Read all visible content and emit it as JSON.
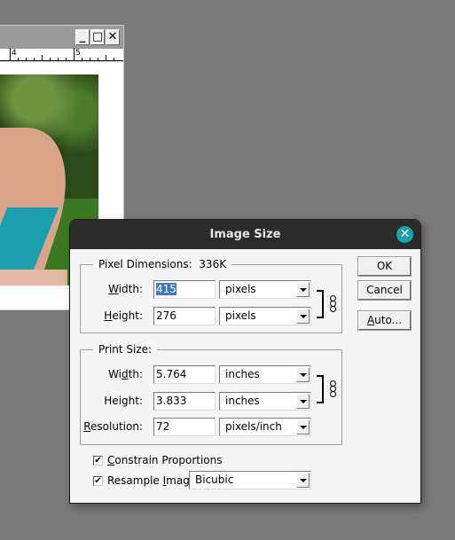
{
  "document_window": {
    "buttons": {
      "minimize": "_",
      "maximize": "□",
      "close": "✕"
    },
    "ruler": {
      "labels": [
        "4",
        "5"
      ]
    }
  },
  "dialog": {
    "title": "Image Size",
    "close_icon": "✕",
    "pixel_dimensions": {
      "title": "Pixel Dimensions:",
      "size": "336K",
      "width": {
        "label_prefix": "",
        "label_mnemonic": "W",
        "label_rest": "idth:",
        "value": "415",
        "unit": "pixels"
      },
      "height": {
        "label_mnemonic": "H",
        "label_rest": "eight:",
        "value": "276",
        "unit": "pixels"
      }
    },
    "print_size": {
      "title": "Print Size:",
      "width": {
        "label_prefix": "Wi",
        "label_mnemonic": "d",
        "label_rest": "th:",
        "value": "5.764",
        "unit": "inches"
      },
      "height": {
        "label": "Height:",
        "value": "3.833",
        "unit": "inches"
      },
      "resolution": {
        "label_mnemonic": "R",
        "label_rest": "esolution:",
        "value": "72",
        "unit": "pixels/inch"
      }
    },
    "constrain_proportions": {
      "mnemonic": "C",
      "label_rest": "onstrain Proportions",
      "checked": true
    },
    "resample_image": {
      "label_prefix": "Resample ",
      "mnemonic": "I",
      "label_rest": "mage:",
      "checked": true,
      "method": "Bicubic"
    },
    "buttons": {
      "ok": "OK",
      "cancel": "Cancel",
      "auto_mnemonic": "A",
      "auto_rest": "uto..."
    },
    "check_glyph": "✔",
    "link_icon": "chain-link"
  }
}
